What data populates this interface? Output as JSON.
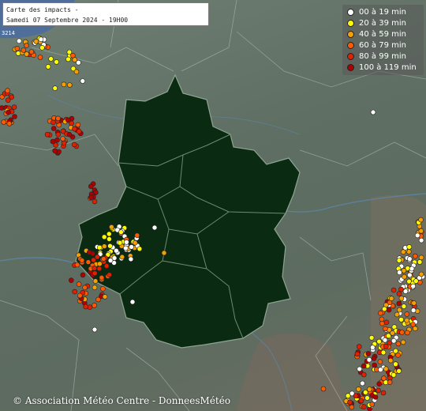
{
  "map": {
    "title_line1": "Carte des impacts -",
    "title_line2": "Samedi 07 Septembre 2024 - 19H00",
    "scale_label": "3214",
    "copyright": "© Association Météo Centre - DonneesMétéo",
    "region_fill": "#0a2a12",
    "region_border": "#8fa593"
  },
  "legend": {
    "items": [
      {
        "label": "00 à 19 min",
        "color": "#ffffff"
      },
      {
        "label": "20 à 39 min",
        "color": "#ffff00"
      },
      {
        "label": "40 à 59 min",
        "color": "#f5a000"
      },
      {
        "label": "60 à 79 min",
        "color": "#ff5a00"
      },
      {
        "label": "80 à 99 min",
        "color": "#e02000"
      },
      {
        "label": "100 à 119 min",
        "color": "#b00000"
      }
    ]
  }
}
